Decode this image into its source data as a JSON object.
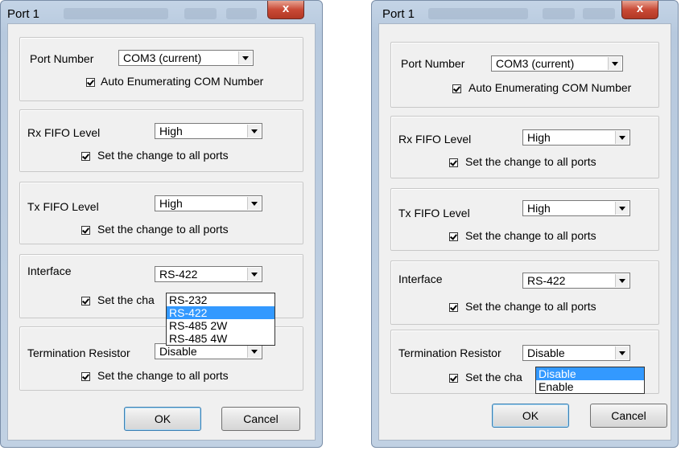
{
  "left": {
    "title": "Port 1",
    "close_glyph": "x",
    "port_number_label": "Port Number",
    "port_number_value": "COM3 (current)",
    "auto_enum_label": "Auto Enumerating COM Number",
    "rx_label": "Rx FIFO Level",
    "rx_value": "High",
    "rx_apply_label": "Set the change to all ports",
    "tx_label": "Tx FIFO Level",
    "tx_value": "High",
    "tx_apply_label": "Set the change to all ports",
    "interface_label": "Interface",
    "interface_value": "RS-422",
    "interface_apply_label": "Set the cha",
    "interface_options": [
      "RS-232",
      "RS-422",
      "RS-485 2W",
      "RS-485 4W"
    ],
    "interface_selected": "RS-422",
    "termination_label": "Termination Resistor",
    "termination_value": "Disable",
    "termination_apply_label": "Set the change to all ports",
    "ok_label": "OK",
    "cancel_label": "Cancel"
  },
  "right": {
    "title": "Port 1",
    "close_glyph": "x",
    "port_number_label": "Port Number",
    "port_number_value": "COM3 (current)",
    "auto_enum_label": "Auto Enumerating COM Number",
    "rx_label": "Rx FIFO Level",
    "rx_value": "High",
    "rx_apply_label": "Set the change to all ports",
    "tx_label": "Tx FIFO Level",
    "tx_value": "High",
    "tx_apply_label": "Set the change to all ports",
    "interface_label": "Interface",
    "interface_value": "RS-422",
    "interface_apply_label": "Set the change to all ports",
    "termination_label": "Termination Resistor",
    "termination_value": "Disable",
    "termination_apply_label": "Set the cha",
    "termination_options": [
      "Disable",
      "Enable"
    ],
    "termination_selected": "Disable",
    "ok_label": "OK",
    "cancel_label": "Cancel"
  },
  "colors": {
    "selection": "#3399ff",
    "dialog_frame": "#c4d4e6",
    "close_button": "#c94a36",
    "client_bg": "#f0f0f0"
  },
  "icons": {
    "close": "close-icon",
    "combo_arrow": "chevron-down-icon",
    "checkbox": "checkmark-icon"
  }
}
